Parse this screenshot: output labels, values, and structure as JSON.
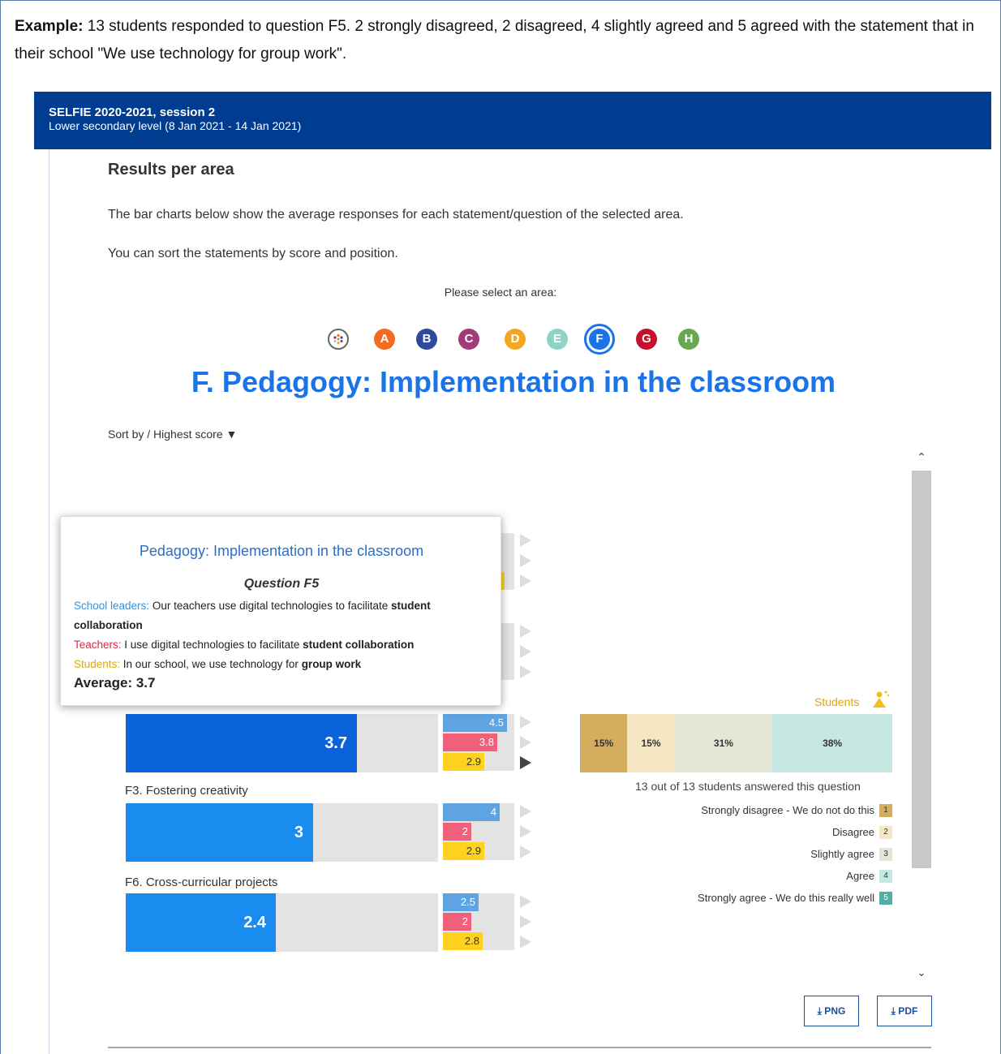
{
  "caption": {
    "bold": "Example:",
    "text": " 13 students responded to question F5. 2 strongly disagreed, 2 disagreed, 4 slightly agreed and 5 agreed with the statement that in their school \"We use technology for group work\"."
  },
  "banner": {
    "title": "SELFIE 2020-2021, session 2",
    "subtitle": "Lower secondary level (8 Jan 2021 - 14 Jan 2021)"
  },
  "section": {
    "heading": "Results per area",
    "intro": "The bar charts below show the average responses for each statement/question of the selected area.",
    "sort_note": "You can sort the statements by score and position.",
    "select_label": "Please select an area:"
  },
  "areas": [
    {
      "label": "",
      "color": "#ffffff"
    },
    {
      "label": "A",
      "color": "#f26b21"
    },
    {
      "label": "B",
      "color": "#2e4a9e"
    },
    {
      "label": "C",
      "color": "#a23b7a"
    },
    {
      "label": "D",
      "color": "#f5a623"
    },
    {
      "label": "E",
      "color": "#8fd3c7"
    },
    {
      "label": "F",
      "color": "#1a73e8"
    },
    {
      "label": "G",
      "color": "#c8102e"
    },
    {
      "label": "H",
      "color": "#6aa84f"
    }
  ],
  "area_title": "F. Pedagogy: Implementation in the classroom",
  "sort_by": "Sort by / Highest score ▼",
  "questions": [
    {
      "label": "",
      "value": "3.7",
      "fraction": 0.74,
      "school_leaders": "4.5",
      "teachers": "3.8",
      "students": "2.9",
      "sl_frac": 0.9,
      "tc_frac": 0.76,
      "st_frac": 0.58
    },
    {
      "label": "F3. Fostering creativity",
      "value": "3",
      "fraction": 0.6,
      "school_leaders": "4",
      "teachers": "2",
      "students": "2.9",
      "sl_frac": 0.8,
      "tc_frac": 0.4,
      "st_frac": 0.58
    },
    {
      "label": "F6. Cross-curricular projects",
      "value": "2.4",
      "fraction": 0.48,
      "school_leaders": "2.5",
      "teachers": "2",
      "students": "2.8",
      "sl_frac": 0.5,
      "tc_frac": 0.4,
      "st_frac": 0.56
    }
  ],
  "distribution": {
    "group_label": "Students",
    "segments": [
      {
        "label": "15%",
        "percent": 15,
        "color": "#d4ad5f"
      },
      {
        "label": "15%",
        "percent": 15,
        "color": "#f6e7c4"
      },
      {
        "label": "31%",
        "percent": 31,
        "color": "#e3e8d6"
      },
      {
        "label": "38%",
        "percent": 38,
        "color": "#c5e8e3"
      }
    ],
    "answered": "13 out of 13 students answered this question",
    "legend": [
      {
        "label": "Strongly disagree - We do not do this",
        "num": "1",
        "color": "#d4ad5f"
      },
      {
        "label": "Disagree",
        "num": "2",
        "color": "#f6e7c4"
      },
      {
        "label": "Slightly agree",
        "num": "3",
        "color": "#e3e8d6"
      },
      {
        "label": "Agree",
        "num": "4",
        "color": "#c5e8e3"
      },
      {
        "label": "Strongly agree - We do this really well",
        "num": "5",
        "color": "#4fb0a5"
      }
    ]
  },
  "downloads": {
    "png": "⤓ PNG",
    "pdf": "⤓ PDF"
  },
  "tooltip": {
    "title": "Pedagogy: Implementation in the classroom",
    "question": "Question F5",
    "sl_label": "School leaders:",
    "sl_text": " Our teachers use digital technologies to facilitate ",
    "sl_bold": "student collaboration",
    "tc_label": "Teachers:",
    "tc_text": " I use digital technologies to facilitate ",
    "tc_bold": "student collaboration",
    "st_label": "Students:",
    "st_text": " In our school, we use technology for ",
    "st_bold": "group work",
    "average": "Average: 3.7"
  }
}
